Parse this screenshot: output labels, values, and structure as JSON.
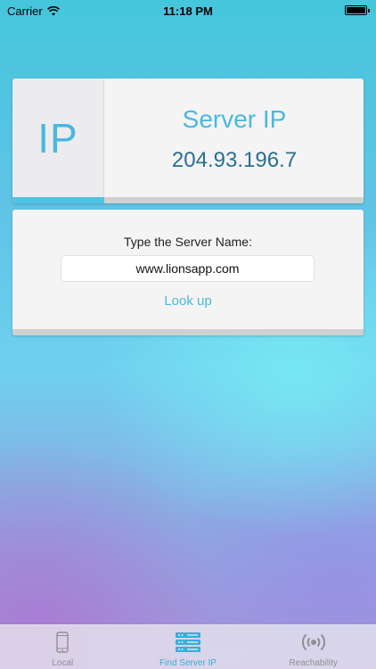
{
  "status_bar": {
    "carrier": "Carrier",
    "time": "11:18 PM"
  },
  "ip_card": {
    "glyph": "IP",
    "title": "Server IP",
    "value": "204.93.196.7"
  },
  "lookup": {
    "label": "Type the Server Name:",
    "input_value": "www.lionsapp.com",
    "button_label": "Look up"
  },
  "tabs": [
    {
      "label": "Local",
      "icon": "phone-icon",
      "active": false
    },
    {
      "label": "Find Server IP",
      "icon": "server-icon",
      "active": true
    },
    {
      "label": "Reachability",
      "icon": "broadcast-icon",
      "active": false
    }
  ],
  "colors": {
    "accent": "#4bb8dd",
    "ip_value": "#2a6f8f",
    "inactive_tab": "#8f8f95"
  }
}
